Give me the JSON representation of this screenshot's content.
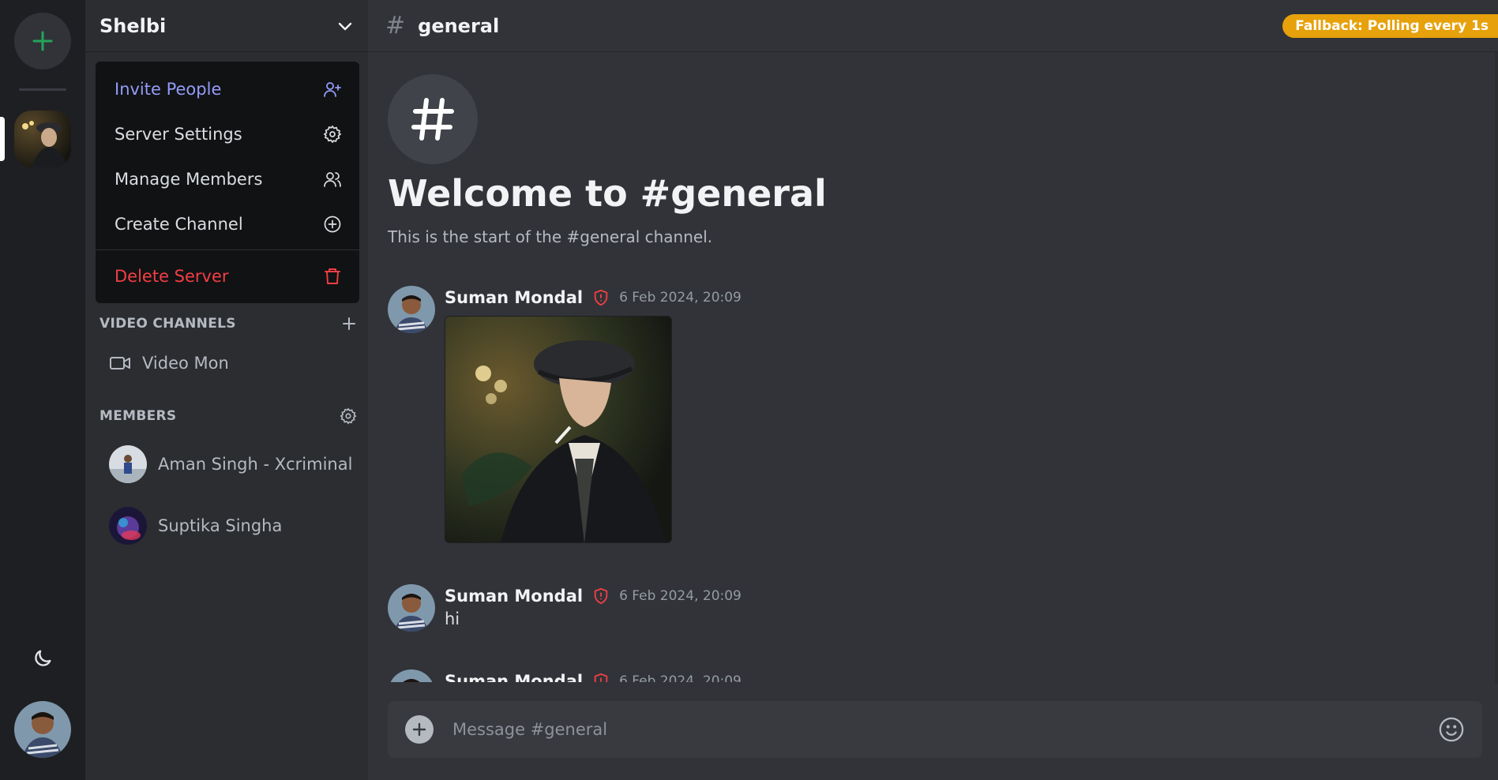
{
  "server": {
    "name": "Shelbi",
    "menu": {
      "invite": "Invite People",
      "settings": "Server Settings",
      "members": "Manage Members",
      "create_channel": "Create Channel",
      "delete": "Delete Server"
    }
  },
  "sidebar": {
    "video_section": "VIDEO CHANNELS",
    "video_channel": "Video Mon",
    "members_section": "MEMBERS",
    "members": [
      "Aman Singh - Xcriminal",
      "Suptika Singha"
    ]
  },
  "channel": {
    "hash": "#",
    "name": "general",
    "welcome_title": "Welcome to #general",
    "welcome_sub": "This is the start of the #general channel."
  },
  "status_badge": "Fallback: Polling every 1s",
  "messages": [
    {
      "author": "Suman Mondal",
      "time": "6 Feb 2024, 20:09",
      "text": "",
      "has_image": true
    },
    {
      "author": "Suman Mondal",
      "time": "6 Feb 2024, 20:09",
      "text": "hi"
    },
    {
      "author": "Suman Mondal",
      "time": "6 Feb 2024, 20:09",
      "text": ""
    }
  ],
  "composer": {
    "placeholder": "Message #general"
  },
  "colors": {
    "accent_green": "#23a55a",
    "invite_purple": "#949cf7",
    "danger_red": "#f23f43",
    "badge_amber": "#e6a10b"
  },
  "icons": {
    "add_server": "plus-icon",
    "theme": "moon-icon",
    "invite": "user-plus-icon",
    "settings": "gear-icon",
    "members": "users-icon",
    "create": "plus-circle-icon",
    "delete": "trash-icon",
    "video": "video-camera-icon",
    "moderator": "shield-alert-icon",
    "emoji": "smile-icon"
  }
}
